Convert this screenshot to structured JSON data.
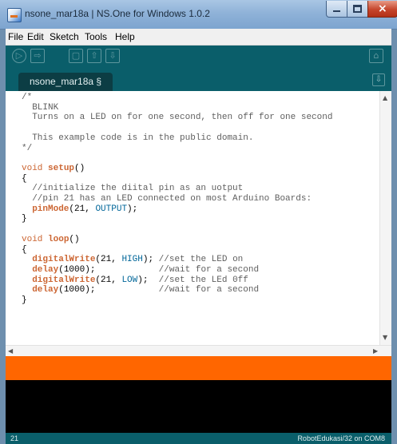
{
  "window": {
    "title": "nsone_mar18a | NS.One for Windows 1.0.2"
  },
  "menu": [
    "File",
    "Edit",
    "Sketch",
    "Tools",
    "Help"
  ],
  "toolbar": {
    "icons": [
      "verify-icon",
      "upload-icon",
      "new-icon",
      "open-icon",
      "save-icon",
      "serial-monitor-icon"
    ],
    "glyphs": {
      "verify": "▷",
      "upload": "⇨",
      "new": "▢",
      "open": "⇧",
      "save": "⇩",
      "serial": "⌂"
    }
  },
  "tab": {
    "label": "nsone_mar18a §",
    "menu_glyph": "⇩"
  },
  "editor": {
    "lines": [
      [
        {
          "t": "/*",
          "c": "cm"
        }
      ],
      [
        {
          "t": "  BLINK",
          "c": "cm"
        }
      ],
      [
        {
          "t": "  Turns on a LED on for one second, then off for one second",
          "c": "cm"
        }
      ],
      [
        {
          "t": "",
          "c": ""
        }
      ],
      [
        {
          "t": "  This example code is in the public domain.",
          "c": "cm"
        }
      ],
      [
        {
          "t": "*/",
          "c": "cm"
        }
      ],
      [
        {
          "t": "",
          "c": ""
        }
      ],
      [
        {
          "t": "void ",
          "c": "kw"
        },
        {
          "t": "setup",
          "c": "fn"
        },
        {
          "t": "()",
          "c": ""
        }
      ],
      [
        {
          "t": "{",
          "c": ""
        }
      ],
      [
        {
          "t": "  //initialize the diital pin as an uotput",
          "c": "cm"
        }
      ],
      [
        {
          "t": "  //pin 21 has an LED connected on most Arduino Boards:",
          "c": "cm"
        }
      ],
      [
        {
          "t": "  ",
          "c": ""
        },
        {
          "t": "pinMode",
          "c": "fn"
        },
        {
          "t": "(21, ",
          "c": ""
        },
        {
          "t": "OUTPUT",
          "c": "cst"
        },
        {
          "t": ");",
          "c": ""
        }
      ],
      [
        {
          "t": "}",
          "c": ""
        }
      ],
      [
        {
          "t": "",
          "c": ""
        }
      ],
      [
        {
          "t": "void ",
          "c": "kw"
        },
        {
          "t": "loop",
          "c": "fn"
        },
        {
          "t": "()",
          "c": ""
        }
      ],
      [
        {
          "t": "{",
          "c": ""
        }
      ],
      [
        {
          "t": "  ",
          "c": ""
        },
        {
          "t": "digitalWrite",
          "c": "fn"
        },
        {
          "t": "(21, ",
          "c": ""
        },
        {
          "t": "HIGH",
          "c": "cst"
        },
        {
          "t": "); ",
          "c": ""
        },
        {
          "t": "//set the LED on",
          "c": "cm"
        }
      ],
      [
        {
          "t": "  ",
          "c": ""
        },
        {
          "t": "delay",
          "c": "fn"
        },
        {
          "t": "(1000);            ",
          "c": ""
        },
        {
          "t": "//wait for a second",
          "c": "cm"
        }
      ],
      [
        {
          "t": "  ",
          "c": ""
        },
        {
          "t": "digitalWrite",
          "c": "fn"
        },
        {
          "t": "(21, ",
          "c": ""
        },
        {
          "t": "LOW",
          "c": "cst"
        },
        {
          "t": ");  ",
          "c": ""
        },
        {
          "t": "//set the LEd 0ff",
          "c": "cm"
        }
      ],
      [
        {
          "t": "  ",
          "c": ""
        },
        {
          "t": "delay",
          "c": "fn"
        },
        {
          "t": "(1000);            ",
          "c": ""
        },
        {
          "t": "//wait for a second",
          "c": "cm"
        }
      ],
      [
        {
          "t": "}",
          "c": ""
        }
      ]
    ]
  },
  "status": {
    "line": "21",
    "board": "RobotEdukasi/32 on COM8"
  },
  "colors": {
    "toolbar": "#0a5e6a",
    "status_bar": "#ff6600",
    "console": "#000000"
  }
}
